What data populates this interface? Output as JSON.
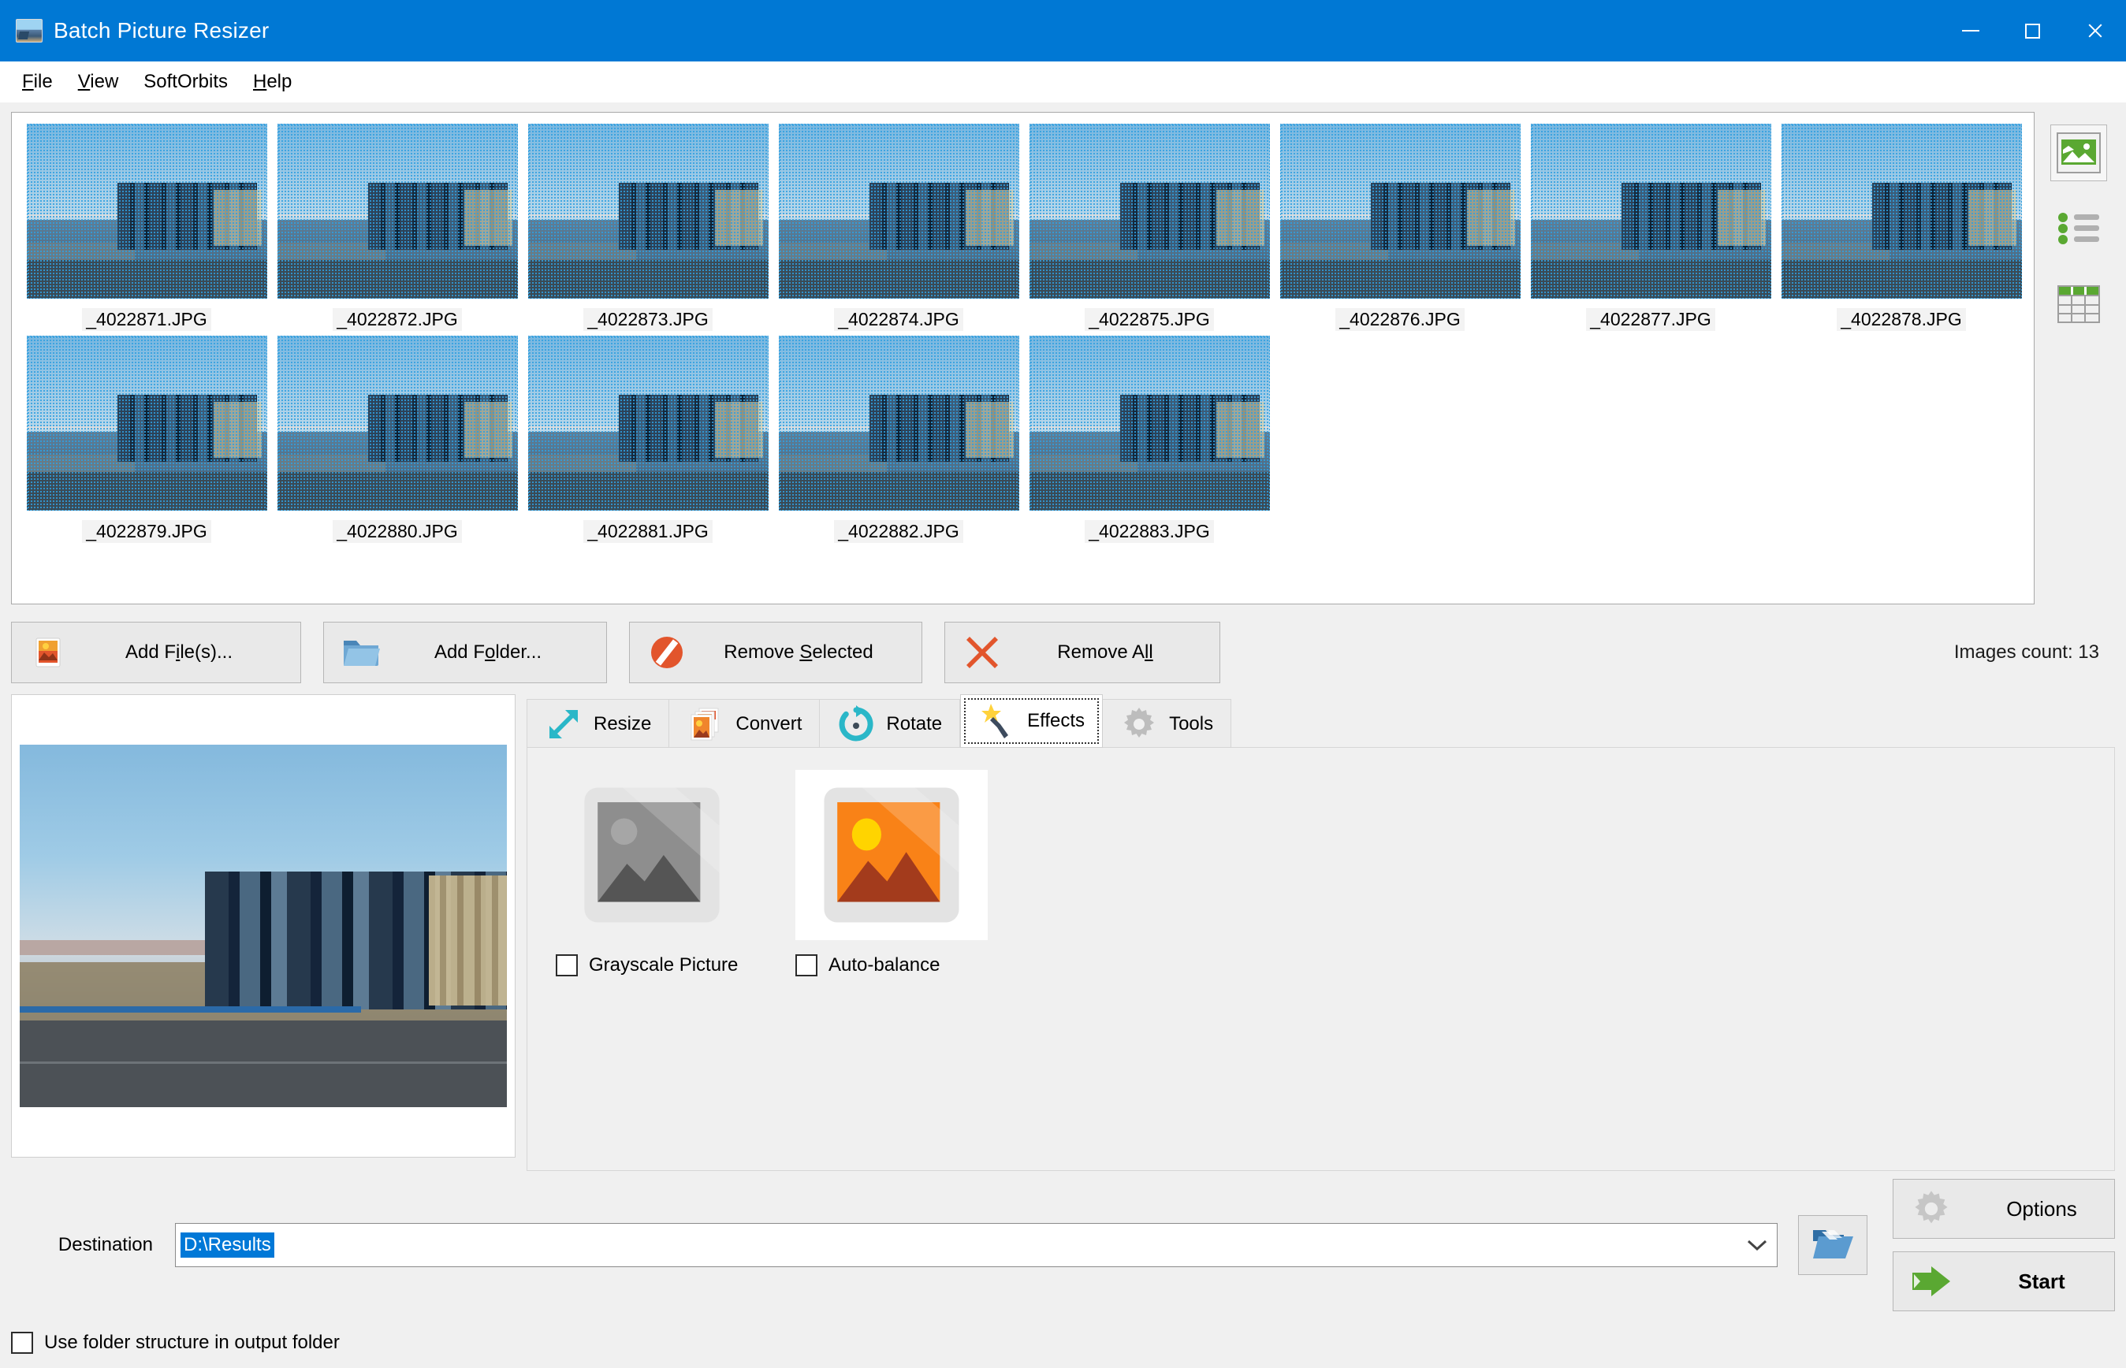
{
  "window": {
    "title": "Batch Picture Resizer",
    "icon": "app-picture-icon",
    "minimize": "minimize",
    "maximize": "maximize",
    "close": "close"
  },
  "menubar": {
    "items": [
      {
        "label": "File",
        "accel": "F"
      },
      {
        "label": "View",
        "accel": "V"
      },
      {
        "label": "SoftOrbits",
        "accel": ""
      },
      {
        "label": "Help",
        "accel": "H"
      }
    ]
  },
  "thumbnails": {
    "row1": [
      {
        "filename": "_4022871.JPG",
        "selected": true
      },
      {
        "filename": "_4022872.JPG",
        "selected": true
      },
      {
        "filename": "_4022873.JPG",
        "selected": true
      },
      {
        "filename": "_4022874.JPG",
        "selected": true
      },
      {
        "filename": "_4022875.JPG",
        "selected": true
      },
      {
        "filename": "_4022876.JPG",
        "selected": true
      },
      {
        "filename": "_4022877.JPG",
        "selected": true
      },
      {
        "filename": "_4022878.JPG",
        "selected": true
      }
    ],
    "row2": [
      {
        "filename": "_4022879.JPG",
        "selected": true
      },
      {
        "filename": "_4022880.JPG",
        "selected": true
      },
      {
        "filename": "_4022881.JPG",
        "selected": true
      },
      {
        "filename": "_4022882.JPG",
        "selected": true
      },
      {
        "filename": "_4022883.JPG",
        "selected": true
      }
    ]
  },
  "view_modes": [
    {
      "name": "thumbnail-view",
      "icon": "picture-icon",
      "active": true
    },
    {
      "name": "list-view",
      "icon": "list-icon",
      "active": false
    },
    {
      "name": "details-view",
      "icon": "table-icon",
      "active": false
    }
  ],
  "toolbar": {
    "add_files": {
      "label_a": "Add F",
      "accel": "i",
      "label_b": "le(s)...",
      "icon": "add-picture-icon"
    },
    "add_folder": {
      "label_a": "Add F",
      "accel": "o",
      "label_b": "lder...",
      "icon": "folder-icon"
    },
    "remove_selected": {
      "label_a": "Remove ",
      "accel": "S",
      "label_b": "elected",
      "icon": "no-entry-icon"
    },
    "remove_all": {
      "label_a": "Remove A",
      "accel": "ll",
      "label_b": "",
      "icon": "red-x-icon"
    },
    "images_count": "Images count: 13"
  },
  "preview": {
    "alt": "cityscape-photo-preview"
  },
  "tabs": [
    {
      "label": "Resize",
      "icon": "resize-arrow-icon",
      "active": false
    },
    {
      "label": "Convert",
      "icon": "convert-images-icon",
      "active": false
    },
    {
      "label": "Rotate",
      "icon": "rotate-icon",
      "active": false
    },
    {
      "label": "Effects",
      "icon": "magic-wand-icon",
      "active": true
    },
    {
      "label": "Tools",
      "icon": "gear-icon",
      "active": false
    }
  ],
  "effects": [
    {
      "label": "Grayscale Picture",
      "checked": false,
      "preview": "grayscale-preview-icon",
      "highlight": false
    },
    {
      "label": "Auto-balance",
      "checked": false,
      "preview": "color-preview-icon",
      "highlight": true
    }
  ],
  "destination": {
    "label": "Destination",
    "value": "D:\\Results",
    "placeholder": "",
    "selected": true,
    "dropdown_icon": "chevron-down-icon",
    "browse_icon": "open-folder-icon"
  },
  "use_folder_structure": {
    "label": "Use folder structure in output folder",
    "checked": false
  },
  "actions": {
    "options": {
      "label": "Options",
      "icon": "gear-icon"
    },
    "start": {
      "label": "Start",
      "icon": "green-arrow-icon"
    }
  },
  "colors": {
    "titlebar": "#0078d4",
    "accent_green": "#5aa832",
    "accent_orange": "#e2552c",
    "accent_cyan": "#2ab7c8",
    "selection_blue": "#0078d7",
    "window_bg": "#f0f0f0"
  }
}
